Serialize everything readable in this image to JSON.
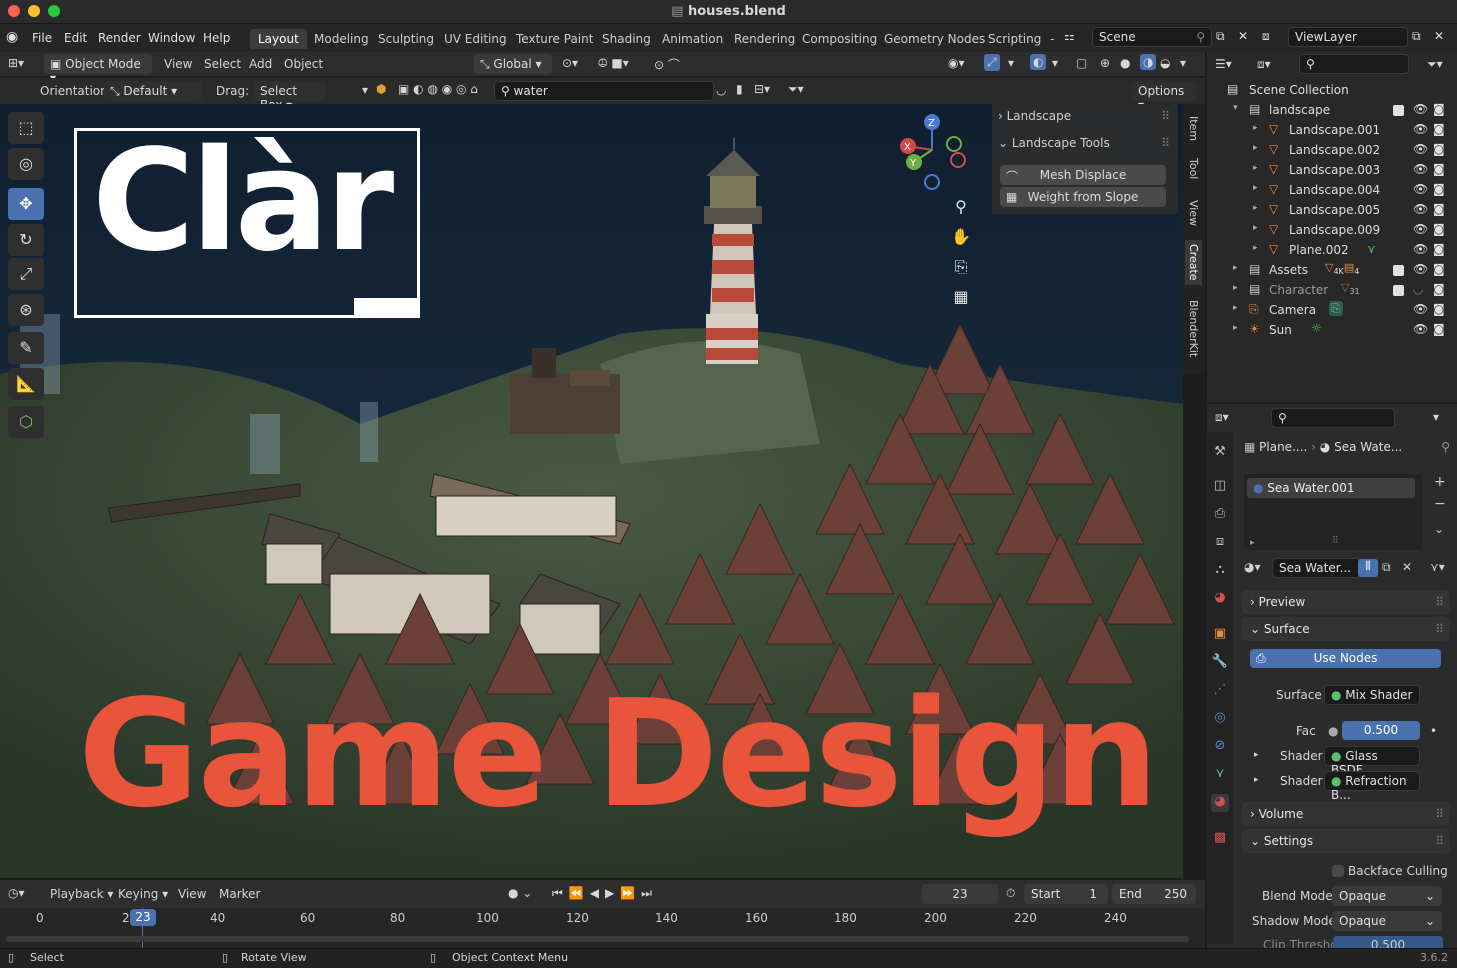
{
  "window": {
    "title": "houses.blend"
  },
  "menu": {
    "file": "File",
    "edit": "Edit",
    "render": "Render",
    "window": "Window",
    "help": "Help"
  },
  "workspaces": [
    "Layout",
    "Modeling",
    "Sculpting",
    "UV Editing",
    "Texture Paint",
    "Shading",
    "Animation",
    "Rendering",
    "Compositing",
    "Geometry Nodes",
    "Scripting"
  ],
  "active_workspace": "Layout",
  "scene": {
    "name": "Scene",
    "view_layer": "ViewLayer"
  },
  "viewport_header": {
    "mode": "Object Mode",
    "view": "View",
    "select": "Select",
    "add": "Add",
    "object": "Object",
    "transform": "Global"
  },
  "viewport_header2": {
    "orientation_label": "Orientation:",
    "orientation_value": "Default",
    "drag_label": "Drag:",
    "drag_value": "Select Box",
    "search_value": "water",
    "options": "Options"
  },
  "npanel": {
    "section1": "Landscape",
    "section2": "Landscape Tools",
    "btn1": "Mesh Displace",
    "btn2": "Weight from Slope"
  },
  "sidebar_tabs": [
    "Item",
    "Tool",
    "View",
    "Create",
    "BlenderKit"
  ],
  "overlay": {
    "logo_text": "Clàr",
    "title": "Game Design"
  },
  "outliner": {
    "root": "Scene Collection",
    "rows": [
      {
        "label": "landscape",
        "indent": 1
      },
      {
        "label": "Landscape.001",
        "indent": 2
      },
      {
        "label": "Landscape.002",
        "indent": 2
      },
      {
        "label": "Landscape.003",
        "indent": 2
      },
      {
        "label": "Landscape.004",
        "indent": 2
      },
      {
        "label": "Landscape.005",
        "indent": 2
      },
      {
        "label": "Landscape.009",
        "indent": 2
      },
      {
        "label": "Plane.002",
        "indent": 2
      },
      {
        "label": "Assets",
        "indent": 1
      },
      {
        "label": "Character",
        "indent": 1
      },
      {
        "label": "Camera",
        "indent": 1
      },
      {
        "label": "Sun",
        "indent": 1
      }
    ],
    "assets_badge1": "4K",
    "assets_badge2": "4",
    "character_badge": "31"
  },
  "properties": {
    "breadcrumb_obj": "Plane....",
    "breadcrumb_mat": "Sea Wate...",
    "material_slot": "Sea Water.001",
    "material_name": "Sea Water...",
    "preview": "Preview",
    "surface": "Surface",
    "use_nodes": "Use Nodes",
    "surface_label": "Surface",
    "surface_value": "Mix Shader",
    "fac_label": "Fac",
    "fac_value": "0.500",
    "shader_label": "Shader",
    "shader1": "Glass BSDF",
    "shader2": "Refraction B...",
    "volume": "Volume",
    "settings": "Settings",
    "backface": "Backface Culling",
    "blend_mode_label": "Blend Mode",
    "blend_mode": "Opaque",
    "shadow_mode_label": "Shadow Mode",
    "shadow_mode": "Opaque",
    "clip_label": "Clip Threshold",
    "clip_value": "0.500"
  },
  "timeline": {
    "playback": "Playback",
    "keying": "Keying",
    "view": "View",
    "marker": "Marker",
    "current_frame": "23",
    "start_label": "Start",
    "start": "1",
    "end_label": "End",
    "end": "250",
    "ticks": [
      "0",
      "2",
      "40",
      "60",
      "80",
      "100",
      "120",
      "140",
      "160",
      "180",
      "200",
      "220",
      "240"
    ],
    "playhead": "23"
  },
  "status": {
    "select": "Select",
    "rotate": "Rotate View",
    "context": "Object Context Menu",
    "version": "3.6.2"
  }
}
